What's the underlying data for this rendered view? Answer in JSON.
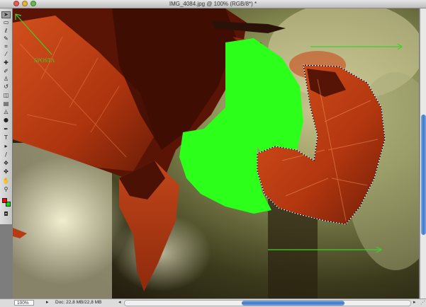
{
  "window": {
    "title": "IMG_4084.jpg @ 100% (RGB/8*) *",
    "buttons": [
      "close",
      "minimize",
      "zoom"
    ]
  },
  "toolbox": {
    "tools": [
      {
        "name": "move-tool-icon",
        "glyph": "➤",
        "active": true
      },
      {
        "name": "marquee-tool-icon",
        "glyph": "▭"
      },
      {
        "name": "lasso-tool-icon",
        "glyph": "ℓ"
      },
      {
        "name": "quick-selection-tool-icon",
        "glyph": "✎"
      },
      {
        "name": "crop-tool-icon",
        "glyph": "⌗"
      },
      {
        "name": "eyedropper-tool-icon",
        "glyph": "⁄"
      },
      {
        "name": "healing-brush-tool-icon",
        "glyph": "✚"
      },
      {
        "name": "brush-tool-icon",
        "glyph": "✐"
      },
      {
        "name": "clone-stamp-tool-icon",
        "glyph": "♙"
      },
      {
        "name": "history-brush-tool-icon",
        "glyph": "↺"
      },
      {
        "name": "eraser-tool-icon",
        "glyph": "◫"
      },
      {
        "name": "gradient-tool-icon",
        "glyph": "▤"
      },
      {
        "name": "blur-tool-icon",
        "glyph": "◬"
      },
      {
        "name": "dodge-tool-icon",
        "glyph": "●"
      },
      {
        "name": "pen-tool-icon",
        "glyph": "✒"
      },
      {
        "name": "type-tool-icon",
        "glyph": "T"
      },
      {
        "name": "path-selection-tool-icon",
        "glyph": "▸"
      },
      {
        "name": "shape-tool-icon",
        "glyph": "/"
      },
      {
        "name": "3d-rotate-tool-icon",
        "glyph": "✥"
      },
      {
        "name": "3d-orbit-tool-icon",
        "glyph": "✤"
      },
      {
        "name": "hand-tool-icon",
        "glyph": "✋"
      },
      {
        "name": "zoom-tool-icon",
        "glyph": "⚲"
      }
    ],
    "foreground_color": "#ff0000",
    "background_color": "#00e000",
    "quick_mask_glyph": "◘"
  },
  "canvas": {
    "annotation_label": "SPOSTA",
    "annotation_color": "#3fcf2a",
    "fill_color": "#2cff1a",
    "leaf_color": "#b83a12",
    "selection": "marching-ants"
  },
  "statusbar": {
    "zoom": "100%",
    "doc_size": "Doc: 22,8 MB/22,8 MB",
    "arrow_glyph": "▸",
    "scroll_left_glyph": "◂",
    "scroll_right_glyph": "▸",
    "grip_glyph": "⋰"
  },
  "colors": {
    "accent_scroll": "#3f77c8"
  }
}
